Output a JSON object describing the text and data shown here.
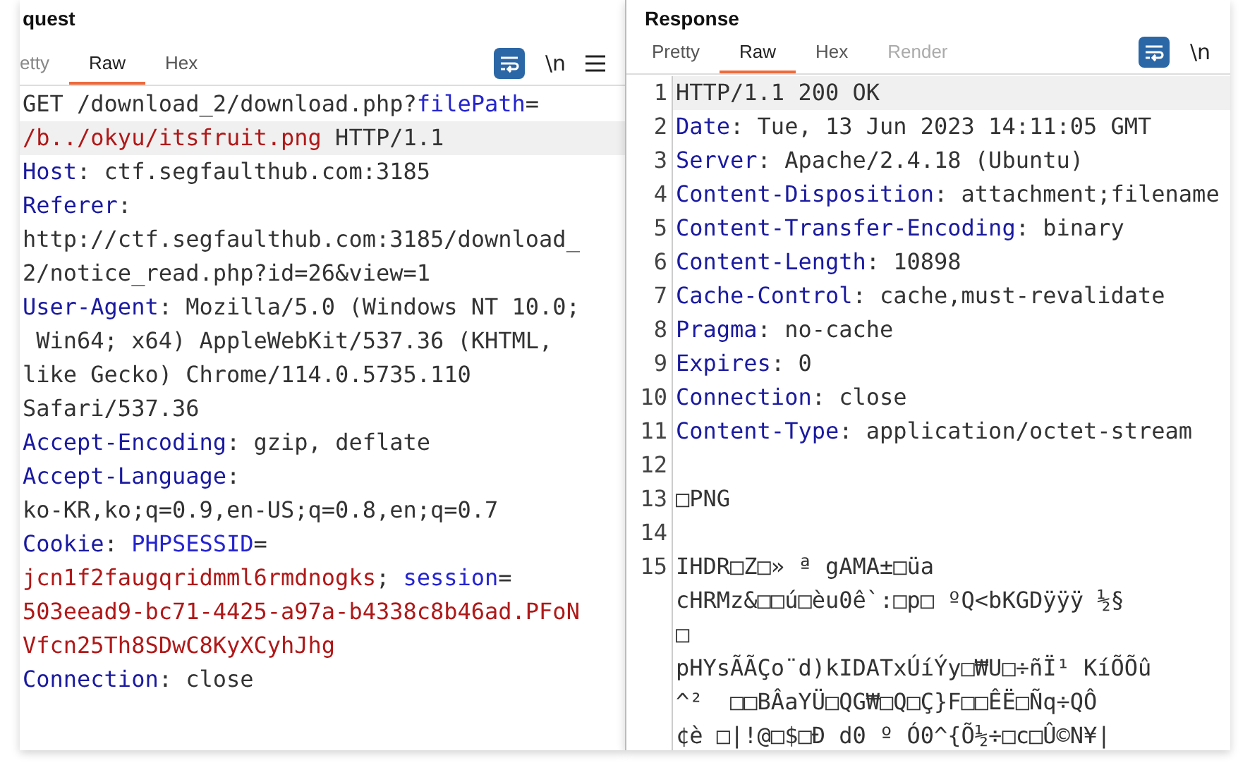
{
  "request": {
    "title": "quest",
    "tabs": [
      {
        "label": "etty",
        "selected": false
      },
      {
        "label": "Raw",
        "selected": true
      },
      {
        "label": "Hex",
        "selected": false
      }
    ],
    "toolbar": {
      "wrap_on": true,
      "newline_label": "\\n",
      "menu": true
    },
    "rows": [
      {
        "highlighted": false,
        "segments": [
          {
            "kind": "plain",
            "text": "GET /download_2/download.php?"
          },
          {
            "kind": "param",
            "text": "filePath"
          },
          {
            "kind": "plain",
            "text": "="
          }
        ]
      },
      {
        "highlighted": true,
        "segments": [
          {
            "kind": "value",
            "text": "/b../okyu/itsfruit.png"
          },
          {
            "kind": "plain",
            "text": " HTTP/1.1"
          }
        ]
      },
      {
        "highlighted": false,
        "segments": [
          {
            "kind": "key",
            "text": "Host"
          },
          {
            "kind": "plain",
            "text": ": ctf.segfaulthub.com:3185"
          }
        ]
      },
      {
        "highlighted": false,
        "segments": [
          {
            "kind": "key",
            "text": "Referer"
          },
          {
            "kind": "plain",
            "text": ":"
          }
        ]
      },
      {
        "highlighted": false,
        "segments": [
          {
            "kind": "plain",
            "text": "http://ctf.segfaulthub.com:3185/download_"
          }
        ]
      },
      {
        "highlighted": false,
        "segments": [
          {
            "kind": "plain",
            "text": "2/notice_read.php?id=26&view=1"
          }
        ]
      },
      {
        "highlighted": false,
        "segments": [
          {
            "kind": "key",
            "text": "User-Agent"
          },
          {
            "kind": "plain",
            "text": ": Mozilla/5.0 (Windows NT 10.0;"
          }
        ]
      },
      {
        "highlighted": false,
        "segments": [
          {
            "kind": "plain",
            "text": " Win64; x64) AppleWebKit/537.36 (KHTML,"
          }
        ]
      },
      {
        "highlighted": false,
        "segments": [
          {
            "kind": "plain",
            "text": "like Gecko) Chrome/114.0.5735.110"
          }
        ]
      },
      {
        "highlighted": false,
        "segments": [
          {
            "kind": "plain",
            "text": "Safari/537.36"
          }
        ]
      },
      {
        "highlighted": false,
        "segments": [
          {
            "kind": "key",
            "text": "Accept-Encoding"
          },
          {
            "kind": "plain",
            "text": ": gzip, deflate"
          }
        ]
      },
      {
        "highlighted": false,
        "segments": [
          {
            "kind": "key",
            "text": "Accept-Language"
          },
          {
            "kind": "plain",
            "text": ":"
          }
        ]
      },
      {
        "highlighted": false,
        "segments": [
          {
            "kind": "plain",
            "text": "ko-KR,ko;q=0.9,en-US;q=0.8,en;q=0.7"
          }
        ]
      },
      {
        "highlighted": false,
        "segments": [
          {
            "kind": "key",
            "text": "Cookie"
          },
          {
            "kind": "plain",
            "text": ": "
          },
          {
            "kind": "param",
            "text": "PHPSESSID"
          },
          {
            "kind": "plain",
            "text": "="
          }
        ]
      },
      {
        "highlighted": false,
        "segments": [
          {
            "kind": "value",
            "text": "jcn1f2faugqridmml6rmdnogks"
          },
          {
            "kind": "plain",
            "text": "; "
          },
          {
            "kind": "param",
            "text": "session"
          },
          {
            "kind": "plain",
            "text": "="
          }
        ]
      },
      {
        "highlighted": false,
        "segments": [
          {
            "kind": "value",
            "text": "503eead9-bc71-4425-a97a-b4338c8b46ad.PFoN"
          }
        ]
      },
      {
        "highlighted": false,
        "segments": [
          {
            "kind": "value",
            "text": "Vfcn25Th8SDwC8KyXCyhJhg"
          }
        ]
      },
      {
        "highlighted": false,
        "segments": [
          {
            "kind": "key",
            "text": "Connection"
          },
          {
            "kind": "plain",
            "text": ": close"
          }
        ]
      }
    ]
  },
  "response": {
    "title": "Response",
    "tabs": [
      {
        "label": "Pretty",
        "selected": false,
        "disabled": false
      },
      {
        "label": "Raw",
        "selected": true,
        "disabled": false
      },
      {
        "label": "Hex",
        "selected": false,
        "disabled": false
      },
      {
        "label": "Render",
        "selected": false,
        "disabled": true
      }
    ],
    "toolbar": {
      "wrap_on": true,
      "newline_label": "\\n"
    },
    "lines": [
      {
        "number": "1",
        "highlighted": true,
        "rows": [
          [
            {
              "kind": "plain",
              "text": "HTTP/1.1 200 OK"
            }
          ]
        ]
      },
      {
        "number": "2",
        "highlighted": false,
        "rows": [
          [
            {
              "kind": "key",
              "text": "Date"
            },
            {
              "kind": "plain",
              "text": ": Tue, 13 Jun 2023 14:11:05 GMT"
            }
          ]
        ]
      },
      {
        "number": "3",
        "highlighted": false,
        "rows": [
          [
            {
              "kind": "key",
              "text": "Server"
            },
            {
              "kind": "plain",
              "text": ": Apache/2.4.18 (Ubuntu)"
            }
          ]
        ]
      },
      {
        "number": "4",
        "highlighted": false,
        "rows": [
          [
            {
              "kind": "key",
              "text": "Content-Disposition"
            },
            {
              "kind": "plain",
              "text": ": attachment;filename"
            }
          ]
        ]
      },
      {
        "number": "5",
        "highlighted": false,
        "rows": [
          [
            {
              "kind": "key",
              "text": "Content-Transfer-Encoding"
            },
            {
              "kind": "plain",
              "text": ": binary"
            }
          ]
        ]
      },
      {
        "number": "6",
        "highlighted": false,
        "rows": [
          [
            {
              "kind": "key",
              "text": "Content-Length"
            },
            {
              "kind": "plain",
              "text": ": 10898"
            }
          ]
        ]
      },
      {
        "number": "7",
        "highlighted": false,
        "rows": [
          [
            {
              "kind": "key",
              "text": "Cache-Control"
            },
            {
              "kind": "plain",
              "text": ": cache,must-revalidate"
            }
          ]
        ]
      },
      {
        "number": "8",
        "highlighted": false,
        "rows": [
          [
            {
              "kind": "key",
              "text": "Pragma"
            },
            {
              "kind": "plain",
              "text": ": no-cache"
            }
          ]
        ]
      },
      {
        "number": "9",
        "highlighted": false,
        "rows": [
          [
            {
              "kind": "key",
              "text": "Expires"
            },
            {
              "kind": "plain",
              "text": ": 0"
            }
          ]
        ]
      },
      {
        "number": "10",
        "highlighted": false,
        "rows": [
          [
            {
              "kind": "key",
              "text": "Connection"
            },
            {
              "kind": "plain",
              "text": ": close"
            }
          ]
        ]
      },
      {
        "number": "11",
        "highlighted": false,
        "rows": [
          [
            {
              "kind": "key",
              "text": "Content-Type"
            },
            {
              "kind": "plain",
              "text": ": application/octet-stream"
            }
          ]
        ]
      },
      {
        "number": "12",
        "highlighted": false
      },
      {
        "number": "13",
        "highlighted": false,
        "rows": [
          [
            {
              "kind": "plain",
              "text": "□PNG"
            }
          ]
        ]
      },
      {
        "number": "14",
        "highlighted": false
      },
      {
        "number": "15",
        "highlighted": false,
        "rows": [
          [
            {
              "kind": "plain",
              "text": "IHDR□Z□» ª gAMA±□üa"
            }
          ],
          [
            {
              "kind": "plain",
              "text": "cHRMz&□□ú□èu0ê`:□p□ ºQ<bKGDÿÿÿ ½§"
            }
          ],
          [
            {
              "kind": "plain",
              "text": "□"
            }
          ],
          [
            {
              "kind": "plain",
              "text": "pHYsÃÃÇo¨d)kIDATxÚíÝy□₩U□÷ñÏ¹ KíÕÕû"
            }
          ],
          [
            {
              "kind": "plain",
              "text": "^²  □□BÂaYÜ□QG₩□Q□Ç}F□□ÊË□Ñq÷QÔ"
            }
          ],
          [
            {
              "kind": "plain",
              "text": "¢è □|!@□$□Ð d0 º Ó0^{Õ½÷□c□Û©N¥|"
            }
          ]
        ]
      }
    ]
  }
}
